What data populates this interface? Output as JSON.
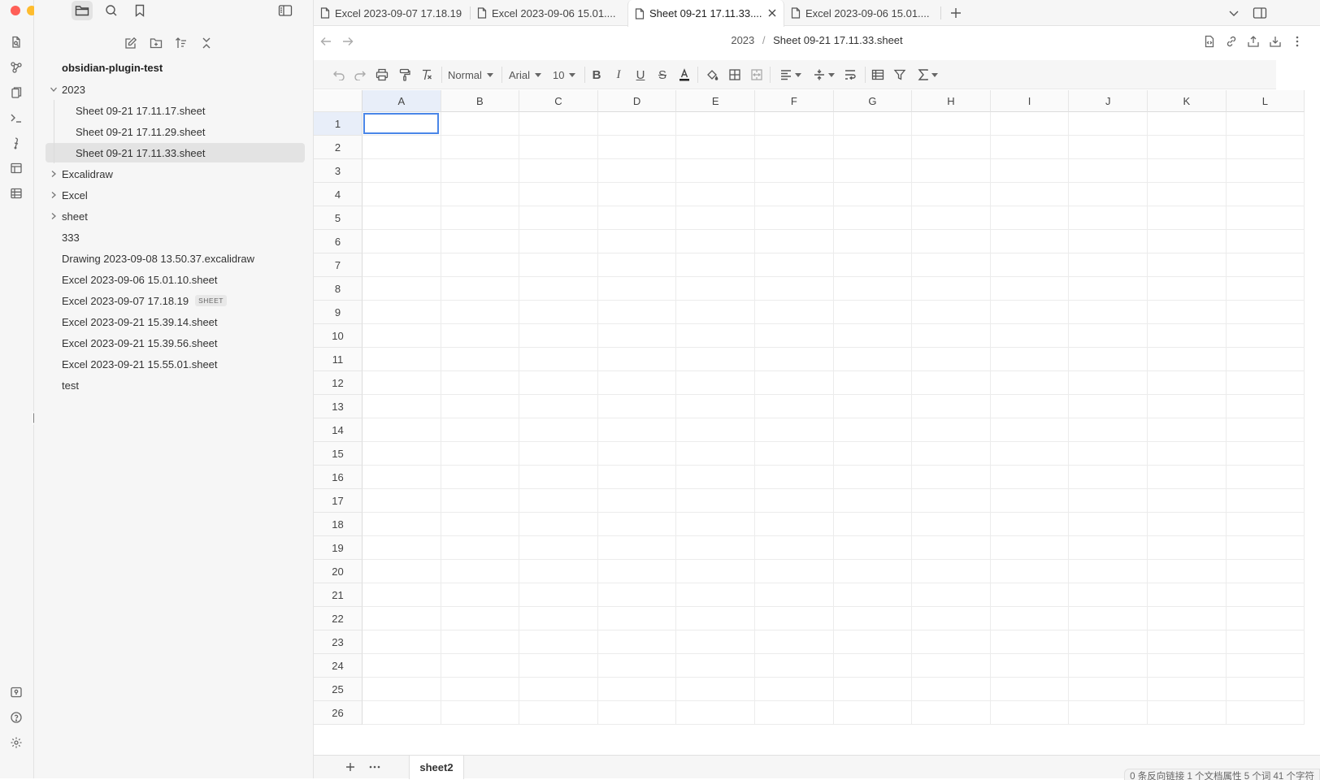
{
  "window": {
    "traffic_colors": [
      "#ff5f57",
      "#febc2e",
      "#28c840"
    ]
  },
  "sidebar": {
    "vault_name": "obsidian-plugin-test",
    "items": [
      {
        "label": "2023",
        "type": "folder",
        "expanded": true,
        "depth": 0
      },
      {
        "label": "Sheet 09-21 17.11.17.sheet",
        "type": "file",
        "depth": 1
      },
      {
        "label": "Sheet 09-21 17.11.29.sheet",
        "type": "file",
        "depth": 1
      },
      {
        "label": "Sheet 09-21 17.11.33.sheet",
        "type": "file",
        "depth": 1,
        "selected": true
      },
      {
        "label": "Excalidraw",
        "type": "folder",
        "expanded": false,
        "depth": 0
      },
      {
        "label": "Excel",
        "type": "folder",
        "expanded": false,
        "depth": 0
      },
      {
        "label": "sheet",
        "type": "folder",
        "expanded": false,
        "depth": 0
      },
      {
        "label": "333",
        "type": "file",
        "depth": 0
      },
      {
        "label": "Drawing 2023-09-08 13.50.37.excalidraw",
        "type": "file",
        "depth": 0
      },
      {
        "label": "Excel 2023-09-06 15.01.10.sheet",
        "type": "file",
        "depth": 0
      },
      {
        "label": "Excel 2023-09-07 17.18.19",
        "type": "file",
        "depth": 0,
        "badge": "SHEET"
      },
      {
        "label": "Excel 2023-09-21 15.39.14.sheet",
        "type": "file",
        "depth": 0
      },
      {
        "label": "Excel 2023-09-21 15.39.56.sheet",
        "type": "file",
        "depth": 0
      },
      {
        "label": "Excel 2023-09-21 15.55.01.sheet",
        "type": "file",
        "depth": 0
      },
      {
        "label": "test",
        "type": "file",
        "depth": 0
      }
    ]
  },
  "tabs": [
    {
      "label": "Excel 2023-09-07 17.18.19"
    },
    {
      "label": "Excel 2023-09-06 15.01...."
    },
    {
      "label": "Sheet 09-21 17.11.33....",
      "active": true
    },
    {
      "label": "Excel 2023-09-06 15.01...."
    }
  ],
  "breadcrumb": {
    "folder": "2023",
    "separator": "/",
    "file": "Sheet 09-21 17.11.33.sheet"
  },
  "toolbar": {
    "style": "Normal",
    "font": "Arial",
    "size": "10"
  },
  "sheet": {
    "columns": [
      "A",
      "B",
      "C",
      "D",
      "E",
      "F",
      "G",
      "H",
      "I",
      "J",
      "K",
      "L"
    ],
    "rows": [
      "1",
      "2",
      "3",
      "4",
      "5",
      "6",
      "7",
      "8",
      "9",
      "10",
      "11",
      "12",
      "13",
      "14",
      "15",
      "16",
      "17",
      "18",
      "19",
      "20",
      "21",
      "22",
      "23",
      "24",
      "25",
      "26"
    ],
    "active_cell": "A1",
    "active_sheet": "sheet2"
  },
  "status": {
    "text": "0 条反向链接 1 个文档属性 5 个词 41 个字符"
  },
  "colors": {
    "accent": "#4a86e8",
    "selection": "#e3e3e3"
  }
}
